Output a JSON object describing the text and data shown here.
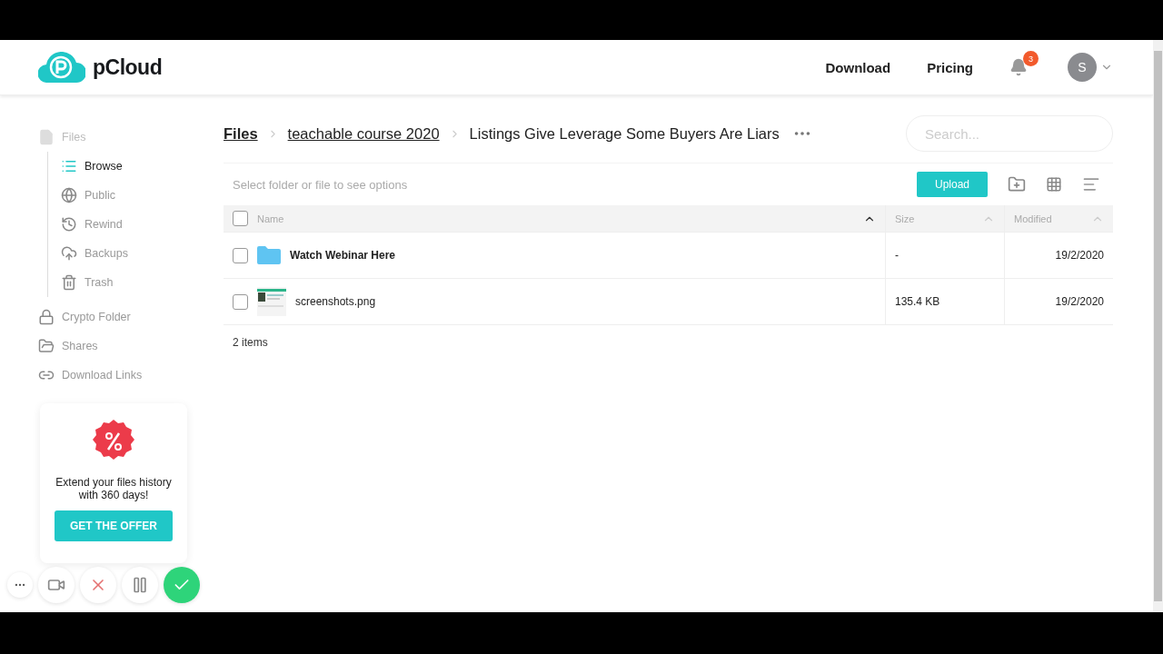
{
  "header": {
    "logo": "pCloud",
    "links": [
      "Download",
      "Pricing"
    ],
    "notifications": "3",
    "avatar": "S"
  },
  "sidebar": {
    "files": "Files",
    "children": [
      {
        "label": "Browse",
        "selected": true
      },
      {
        "label": "Public",
        "selected": false
      },
      {
        "label": "Rewind",
        "selected": false
      },
      {
        "label": "Backups",
        "selected": false
      },
      {
        "label": "Trash",
        "selected": false
      }
    ],
    "items": [
      {
        "label": "Crypto Folder",
        "selected": false
      },
      {
        "label": "Shares",
        "selected": false
      },
      {
        "label": "Download Links",
        "selected": false
      }
    ]
  },
  "breadcrumb": [
    "Files",
    "teachable course 2020",
    "Listings Give Leverage Some Buyers Are Liars"
  ],
  "search": {
    "placeholder": "Search..."
  },
  "toolbar": {
    "hint": "Select folder or file to see options",
    "upload": "Upload"
  },
  "table": {
    "all_checked": false,
    "columns": [
      "Name",
      "Size",
      "Modified"
    ],
    "rows": [
      {
        "kind": "folder",
        "name": "Watch Webinar Here",
        "size": "-",
        "modified": "19/2/2020",
        "checked": false
      },
      {
        "kind": "image",
        "name": "screenshots.png",
        "size": "135.4 KB",
        "modified": "19/2/2020",
        "checked": false
      }
    ],
    "count": "2 items"
  },
  "promo": {
    "text": "Extend your files history with 360 days!",
    "button": "GET THE OFFER"
  }
}
